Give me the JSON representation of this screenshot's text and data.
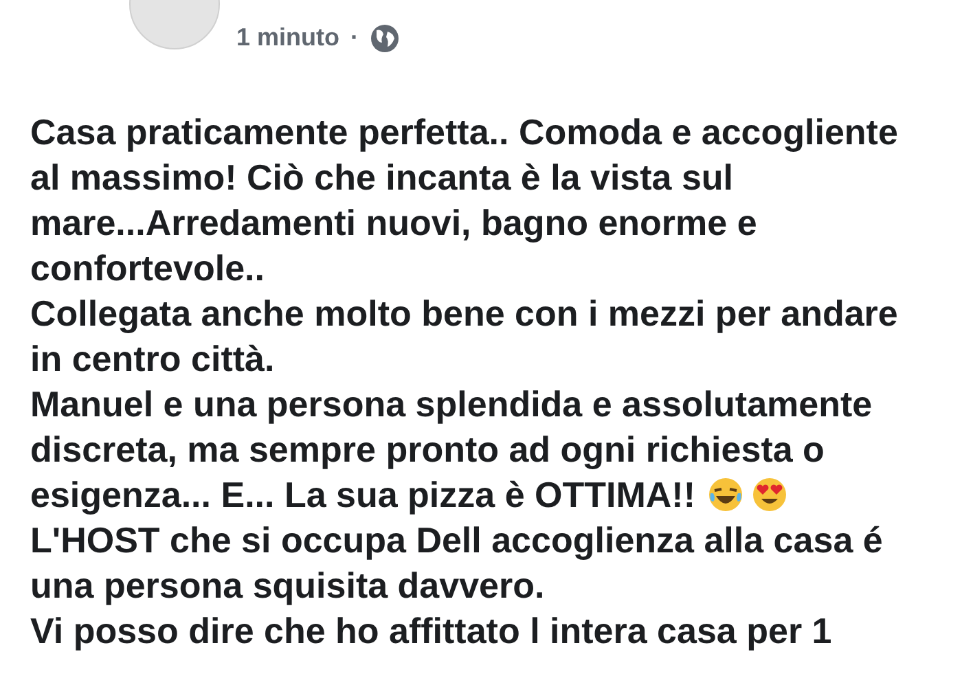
{
  "post": {
    "time": "1 minuto",
    "separator": "·",
    "paragraphs": [
      {
        "text": "Casa praticamente perfetta.. Comoda e accogliente al massimo! Ciò che incanta è la vista sul mare...Arredamenti nuovi, bagno enorme e confortevole.."
      },
      {
        "text": "Collegata anche molto bene con i mezzi per andare in centro città."
      },
      {
        "text": "Manuel e una persona splendida e assolutamente discreta, ma sempre pronto ad ogni richiesta o esigenza... E... La sua pizza è OTTIMA!!",
        "emojis": [
          {
            "kind": "laughing"
          },
          {
            "kind": "heart-eyes"
          }
        ]
      },
      {
        "text": "L'HOST che si occupa Dell accoglienza alla casa é una persona squisita davvero."
      },
      {
        "text": "Vi posso dire che ho affittato l intera casa per 1"
      }
    ]
  }
}
